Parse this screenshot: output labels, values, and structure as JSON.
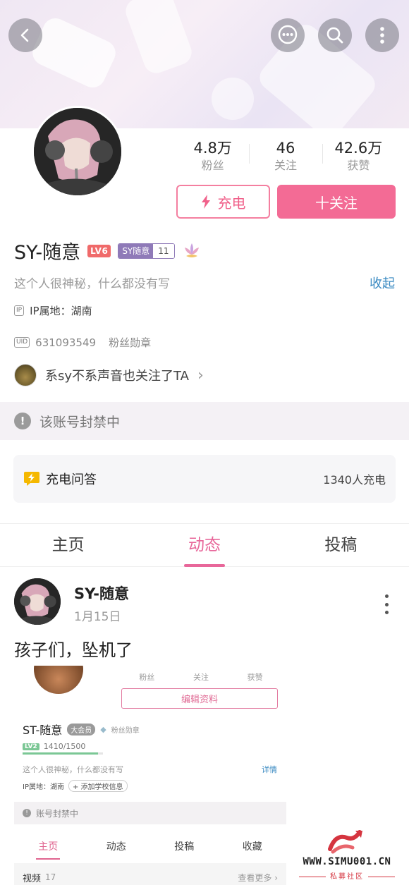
{
  "header": {
    "back_icon": "chevron-left-icon",
    "actions": [
      "chat-bubble-icon",
      "search-icon",
      "more-vertical-icon"
    ]
  },
  "profile": {
    "stats": [
      {
        "value": "4.8万",
        "label": "粉丝"
      },
      {
        "value": "46",
        "label": "关注"
      },
      {
        "value": "42.6万",
        "label": "获赞"
      }
    ],
    "charge_button": "充电",
    "follow_button": "十关注",
    "name": "SY-随意",
    "level_badge": "LV6",
    "medal": {
      "name": "SY随意",
      "level": "11"
    },
    "signature": "这个人很神秘，什么都没有写",
    "collapse_link": "收起",
    "ip_tag": "IP",
    "ip_location": "IP属地：湖南",
    "uid_tag": "UID",
    "uid": "631093549",
    "fan_medal": "粉丝勋章",
    "mutual_prefix": "系sy不系声音",
    "mutual_suffix": "也关注了TA",
    "mutual_arrow": "›"
  },
  "ban_notice": "该账号封禁中",
  "charge_qa": {
    "title": "充电问答",
    "count": "1340人充电"
  },
  "tabs": [
    {
      "label": "主页",
      "active": false
    },
    {
      "label": "动态",
      "active": true
    },
    {
      "label": "投稿",
      "active": false
    }
  ],
  "post": {
    "author": "SY-随意",
    "date": "1月15日",
    "text": "孩子们，坠机了",
    "screenshot": {
      "stats": [
        "粉丝",
        "关注",
        "获赞"
      ],
      "edit_button": "编辑资料",
      "name": "ST-随意",
      "vip_badge": "大会员",
      "fan_medal": "粉丝勋章",
      "level": "LV2",
      "level_progress": "1410/1500",
      "level_fraction": 0.94,
      "signature": "这个人很神秘，什么都没有写",
      "detail_link": "详情",
      "ip_location": "IP属地：湖南",
      "add_school": "添加学校信息",
      "ban_notice": "账号封禁中",
      "tabs": [
        "主页",
        "动态",
        "投稿",
        "收藏"
      ],
      "video_label": "视频",
      "video_count": "17",
      "see_more": "查看更多 ›"
    }
  },
  "watermark": {
    "site": "WWW.SIMU001.CN",
    "sub": "私募社区"
  },
  "colors": {
    "accent_pink": "#f36b95",
    "link_blue": "#3a8ac2",
    "level_red": "#f06a6a"
  }
}
